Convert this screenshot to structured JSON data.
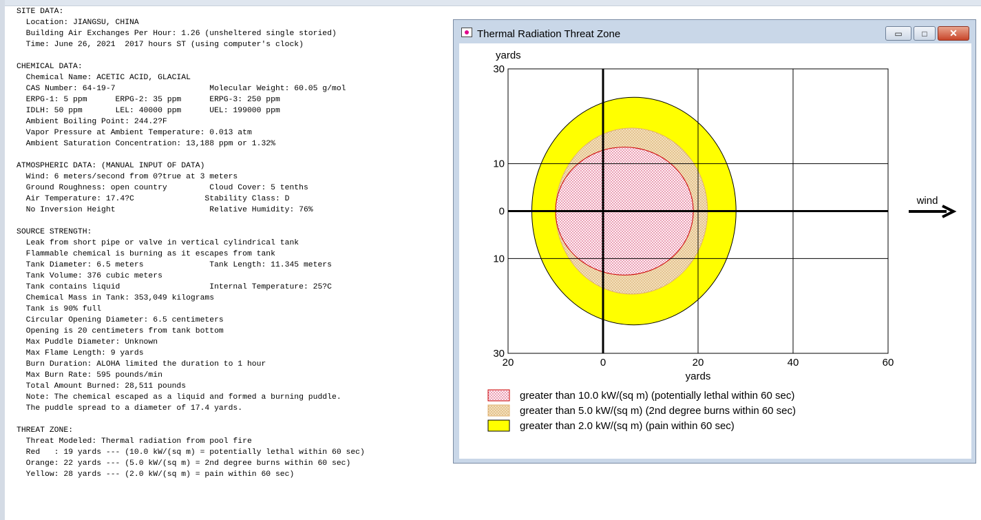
{
  "report_lines": [
    "SITE DATA:",
    "  Location: JIANGSU, CHINA",
    "  Building Air Exchanges Per Hour: 1.26 (unsheltered single storied)",
    "  Time: June 26, 2021  2017 hours ST (using computer's clock)",
    "",
    "CHEMICAL DATA:",
    "  Chemical Name: ACETIC ACID, GLACIAL",
    "  CAS Number: 64-19-7                    Molecular Weight: 60.05 g/mol",
    "  ERPG-1: 5 ppm      ERPG-2: 35 ppm      ERPG-3: 250 ppm",
    "  IDLH: 50 ppm       LEL: 40000 ppm      UEL: 199000 ppm",
    "  Ambient Boiling Point: 244.2?F",
    "  Vapor Pressure at Ambient Temperature: 0.013 atm",
    "  Ambient Saturation Concentration: 13,188 ppm or 1.32%",
    "",
    "ATMOSPHERIC DATA: (MANUAL INPUT OF DATA)",
    "  Wind: 6 meters/second from 0?true at 3 meters",
    "  Ground Roughness: open country         Cloud Cover: 5 tenths",
    "  Air Temperature: 17.4?C               Stability Class: D",
    "  No Inversion Height                    Relative Humidity: 76%",
    "",
    "SOURCE STRENGTH:",
    "  Leak from short pipe or valve in vertical cylindrical tank",
    "  Flammable chemical is burning as it escapes from tank",
    "  Tank Diameter: 6.5 meters              Tank Length: 11.345 meters",
    "  Tank Volume: 376 cubic meters",
    "  Tank contains liquid                   Internal Temperature: 25?C",
    "  Chemical Mass in Tank: 353,049 kilograms",
    "  Tank is 90% full",
    "  Circular Opening Diameter: 6.5 centimeters",
    "  Opening is 20 centimeters from tank bottom",
    "  Max Puddle Diameter: Unknown",
    "  Max Flame Length: 9 yards",
    "  Burn Duration: ALOHA limited the duration to 1 hour",
    "  Max Burn Rate: 595 pounds/min",
    "  Total Amount Burned: 28,511 pounds",
    "  Note: The chemical escaped as a liquid and formed a burning puddle.",
    "  The puddle spread to a diameter of 17.4 yards.",
    "",
    "THREAT ZONE:",
    "  Threat Modeled: Thermal radiation from pool fire",
    "  Red   : 19 yards --- (10.0 kW/(sq m) = potentially lethal within 60 sec)",
    "  Orange: 22 yards --- (5.0 kW/(sq m) = 2nd degree burns within 60 sec)",
    "  Yellow: 28 yards --- (2.0 kW/(sq m) = pain within 60 sec)"
  ],
  "window": {
    "title": "Thermal Radiation Threat Zone",
    "min_glyph": "▭",
    "max_glyph": "□",
    "close_glyph": "✕"
  },
  "chart_data": {
    "type": "threat-zone-plot",
    "x_unit_label": "yards",
    "y_unit_label": "yards",
    "xlim": [
      -20,
      60
    ],
    "ylim": [
      -30,
      30
    ],
    "x_ticks": [
      {
        "value": -20,
        "label": "20"
      },
      {
        "value": 0,
        "label": "0"
      },
      {
        "value": 20,
        "label": "20"
      },
      {
        "value": 40,
        "label": "40"
      },
      {
        "value": 60,
        "label": "60"
      }
    ],
    "y_ticks": [
      {
        "value": 30,
        "label": "30"
      },
      {
        "value": 10,
        "label": "10"
      },
      {
        "value": 0,
        "label": "0"
      },
      {
        "value": -10,
        "label": "10"
      },
      {
        "value": -30,
        "label": "30"
      }
    ],
    "zones": [
      {
        "key": "yellow",
        "downwind_extent": 28,
        "upwind_extent": -15,
        "half_width": 24,
        "fill": "#ffff00",
        "pattern": "none",
        "legend": "greater than 2.0 kW/(sq m) (pain within 60 sec)"
      },
      {
        "key": "orange",
        "downwind_extent": 22,
        "upwind_extent": -10,
        "half_width": 17.5,
        "fill": "#f2dcb7",
        "pattern": "dots-orange",
        "legend": "greater than 5.0 kW/(sq m) (2nd degree burns within 60 sec)"
      },
      {
        "key": "red",
        "downwind_extent": 19,
        "upwind_extent": -10,
        "half_width": 13.5,
        "fill": "#fbeaf0",
        "pattern": "dots-red",
        "legend": "greater than 10.0 kW/(sq m) (potentially lethal within 60 sec)"
      }
    ],
    "legend_order": [
      "red",
      "orange",
      "yellow"
    ],
    "wind_label": "wind",
    "colors": {
      "grid": "#000000",
      "red_outline": "#cc0000",
      "orange_outline": "#e0b070"
    }
  }
}
